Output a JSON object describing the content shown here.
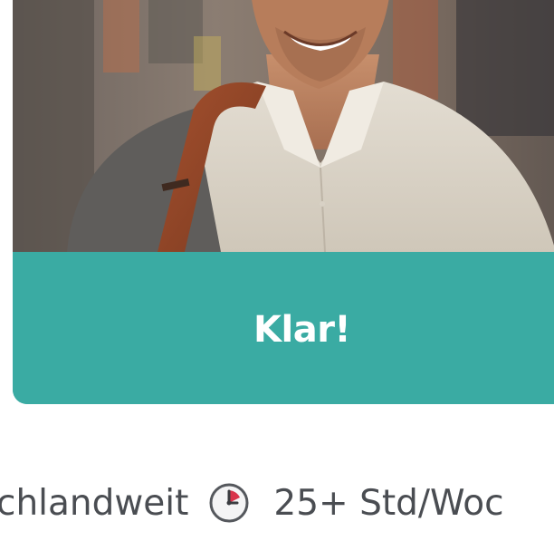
{
  "card": {
    "image_alt": "Smiling man with a shoulder bag",
    "cta_label": "Klar!"
  },
  "info": {
    "location_text": "chlandweit",
    "location_icon": "clock-icon",
    "hours_text": "25+ Std/Woc"
  },
  "colors": {
    "accent": "#3aaba3",
    "text": "#4a4d52",
    "background": "#ffffff"
  }
}
